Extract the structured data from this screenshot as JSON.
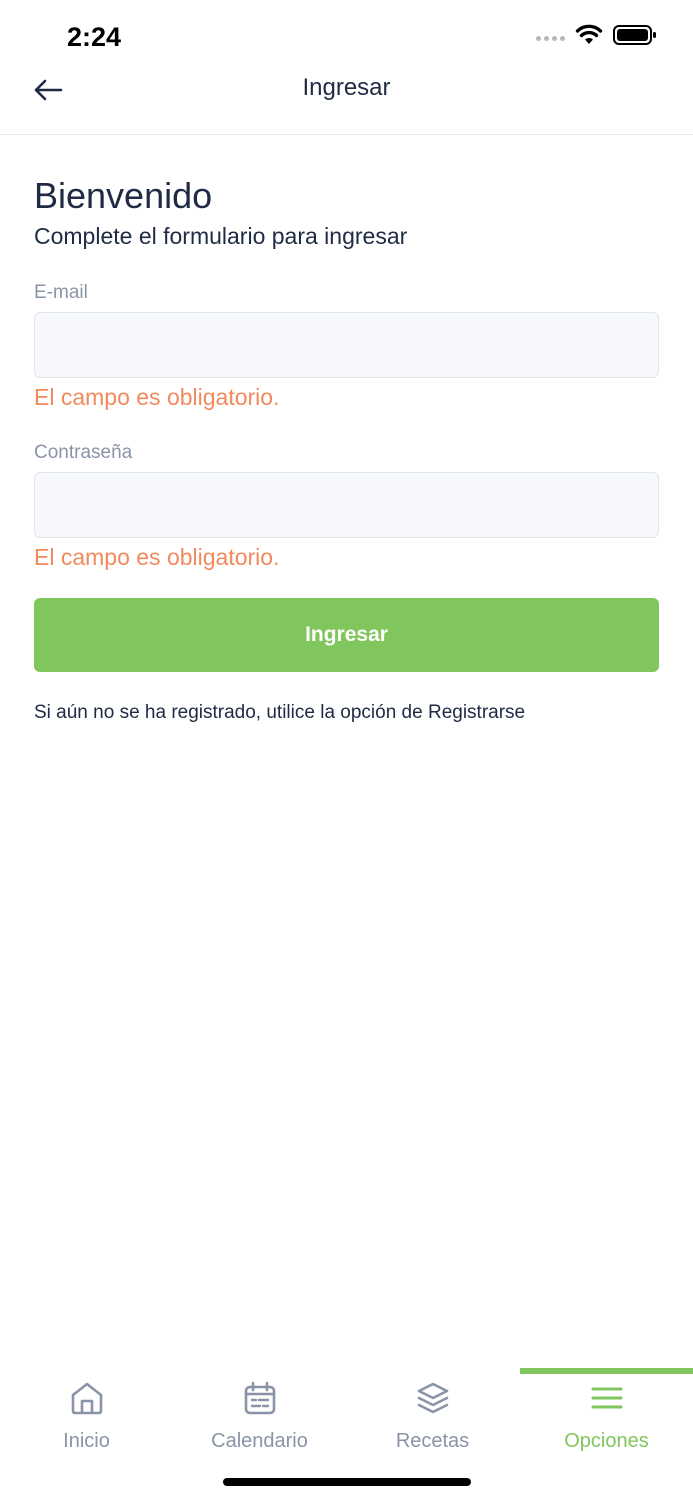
{
  "status_bar": {
    "time": "2:24"
  },
  "nav": {
    "title": "Ingresar"
  },
  "form": {
    "welcome": "Bienvenido",
    "subtitle": "Complete el formulario para ingresar",
    "email_label": "E-mail",
    "email_value": "",
    "email_error": "El campo es obligatorio.",
    "password_label": "Contraseña",
    "password_value": "",
    "password_error": "El campo es obligatorio.",
    "submit_label": "Ingresar",
    "register_hint": "Si aún no se ha registrado, utilice la opción de Registrarse"
  },
  "tabs": [
    {
      "label": "Inicio",
      "icon": "home-icon"
    },
    {
      "label": "Calendario",
      "icon": "calendar-icon"
    },
    {
      "label": "Recetas",
      "icon": "layers-icon"
    },
    {
      "label": "Opciones",
      "icon": "menu-icon",
      "active": true
    }
  ],
  "colors": {
    "accent": "#80c65c",
    "error": "#f28a5c",
    "text_primary": "#1f2a44",
    "text_muted": "#8a94a8",
    "input_bg": "#f7f8fb"
  }
}
